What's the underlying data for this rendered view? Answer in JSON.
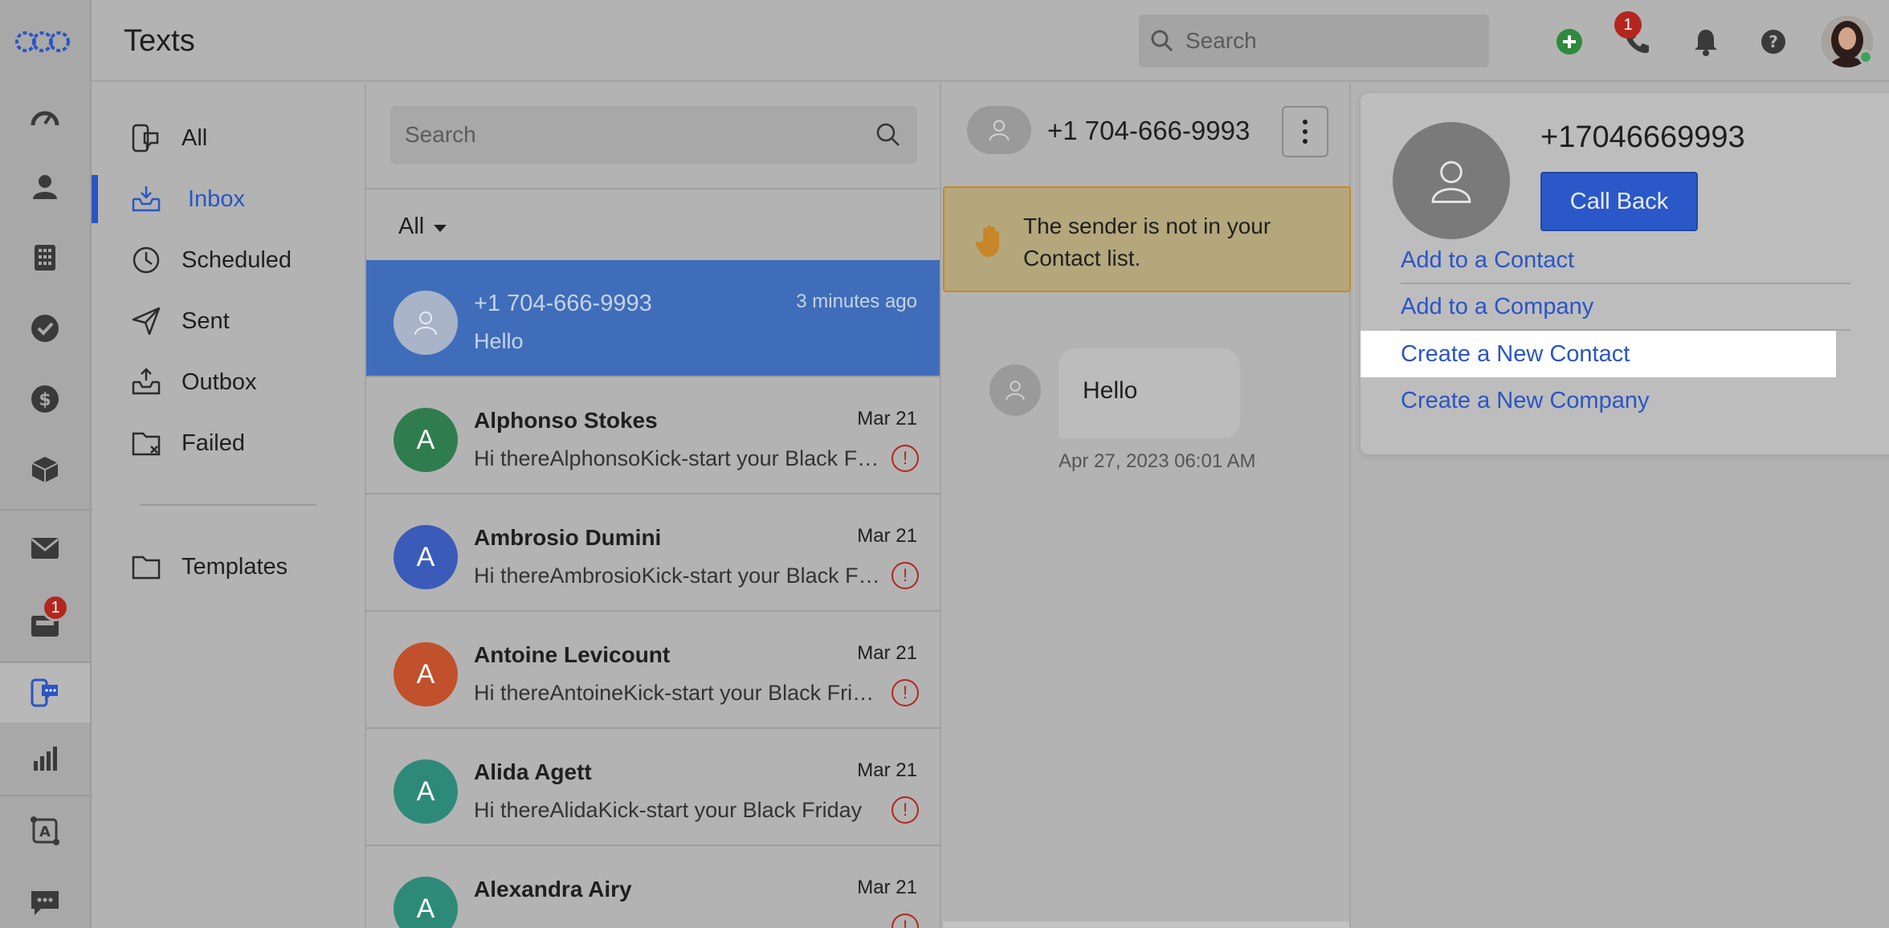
{
  "header": {
    "title": "Texts",
    "search_placeholder": "Search",
    "notification_count": "1"
  },
  "rail": {
    "items": [
      "logo-icon",
      "dashboard-icon",
      "contacts-icon",
      "companies-icon",
      "tasks-icon",
      "deals-icon",
      "products-icon",
      "email-icon",
      "inbox-icon",
      "texts-icon",
      "reports-icon",
      "automation-icon",
      "chat-icon"
    ],
    "inbox_badge": "1"
  },
  "folders": [
    {
      "label": "All"
    },
    {
      "label": "Inbox"
    },
    {
      "label": "Scheduled"
    },
    {
      "label": "Sent"
    },
    {
      "label": "Outbox"
    },
    {
      "label": "Failed"
    },
    {
      "label": "Templates"
    }
  ],
  "conversation_list": {
    "search_placeholder": "Search",
    "filter_label": "All",
    "items": [
      {
        "name": "+1 704-666-9993",
        "time": "3 minutes ago",
        "preview": "Hello",
        "initial": "",
        "color": "#a9b4c8"
      },
      {
        "name": "Alphonso Stokes",
        "time": "Mar 21",
        "preview": "Hi thereAlphonsoKick-start your Black Friday",
        "initial": "A",
        "color": "#2f7d4e"
      },
      {
        "name": "Ambrosio Dumini",
        "time": "Mar 21",
        "preview": "Hi thereAmbrosioKick-start your Black Friday",
        "initial": "A",
        "color": "#3b5bb8"
      },
      {
        "name": "Antoine Levicount",
        "time": "Mar 21",
        "preview": "Hi thereAntoineKick-start your Black Friday",
        "initial": "A",
        "color": "#c0512c"
      },
      {
        "name": "Alida Agett",
        "time": "Mar 21",
        "preview": "Hi thereAlidaKick-start your Black Friday",
        "initial": "A",
        "color": "#2e8a78"
      },
      {
        "name": "Alexandra Airy",
        "time": "Mar 21",
        "preview": "",
        "initial": "A",
        "color": "#2e8a78"
      }
    ]
  },
  "thread": {
    "number": "+1 704-666-9993",
    "notice": "The sender is not in your Contact list.",
    "message": "Hello",
    "message_time": "Apr 27, 2023 06:01 AM"
  },
  "contact_card": {
    "number": "+17046669993",
    "call_back_label": "Call Back",
    "links": [
      "Add to a Contact",
      "Add to a Company",
      "Create a New Contact",
      "Create a New Company"
    ]
  },
  "colors": {
    "accent": "#2a55c4",
    "selected_row": "#3f6dba",
    "error": "#b3261e"
  }
}
